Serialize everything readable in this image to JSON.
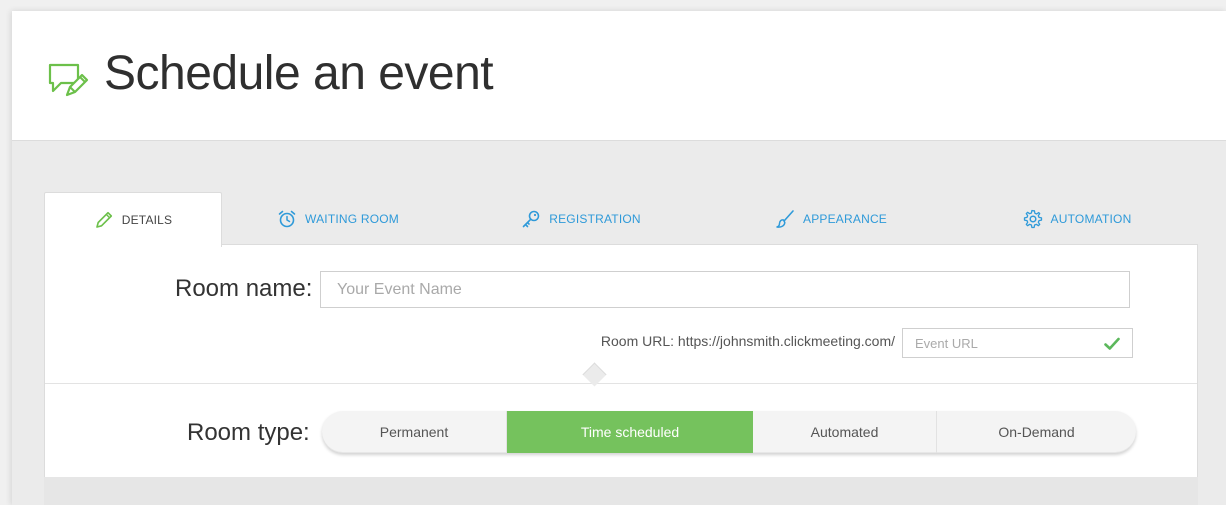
{
  "header": {
    "title": "Schedule an event",
    "icon": "chat-edit-icon",
    "icon_color": "#6cc04a"
  },
  "tabs": [
    {
      "label": "DETAILS",
      "icon": "pencil-icon",
      "active": true
    },
    {
      "label": "WAITING ROOM",
      "icon": "alarm-clock-icon",
      "active": false
    },
    {
      "label": "REGISTRATION",
      "icon": "key-icon",
      "active": false
    },
    {
      "label": "APPEARANCE",
      "icon": "paintbrush-icon",
      "active": false
    },
    {
      "label": "AUTOMATION",
      "icon": "gear-icon",
      "active": false
    }
  ],
  "details": {
    "room_name_label": "Room name:",
    "room_name_placeholder": "Your Event Name",
    "room_name_value": "",
    "room_url_label": "Room URL: https://johnsmith.clickmeeting.com/",
    "event_url_placeholder": "Event URL",
    "event_url_value": "",
    "room_type_label": "Room type:",
    "room_types": [
      "Permanent",
      "Time scheduled",
      "Automated",
      "On-Demand"
    ],
    "room_type_selected": "Time scheduled"
  },
  "colors": {
    "accent_green": "#75c25d",
    "link_blue": "#2f9ad9",
    "check_green": "#5cb85c"
  }
}
